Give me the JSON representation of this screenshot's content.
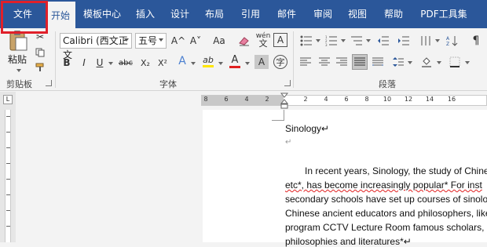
{
  "tabs": {
    "file": "文件",
    "home": "开始",
    "template": "模板中心",
    "insert": "插入",
    "design": "设计",
    "layout": "布局",
    "references": "引用",
    "mailings": "邮件",
    "review": "审阅",
    "view": "视图",
    "help": "帮助",
    "pdf": "PDF工具集"
  },
  "clipboard": {
    "paste_label": "粘贴",
    "group_label": "剪贴板"
  },
  "font": {
    "family": "Calibri (西文正文",
    "size": "五号",
    "group_label": "字体",
    "bold": "B",
    "italic": "I",
    "underline": "U",
    "strike": "abc",
    "subscript": "X₂",
    "superscript": "X²",
    "grow": "A^",
    "shrink": "A˅",
    "change_case": "Aa",
    "phonetic": "wén",
    "char_border": "A",
    "font_color": "A",
    "char_shading": "A",
    "text_effects": "A",
    "highlight": "ab"
  },
  "paragraph": {
    "group_label": "段落"
  },
  "ruler": {
    "ticks": [
      "8",
      "6",
      "4",
      "2",
      "2",
      "4",
      "6",
      "8",
      "10",
      "12",
      "14",
      "16"
    ],
    "corner": "L"
  },
  "document": {
    "lines": [
      "Sinology↵",
      "↵",
      "In recent years, Sinology, the study of Chinese",
      "etc*, has become increasingly popular* For inst",
      "secondary schools have set up courses of sinology,",
      "Chinese ancient educators and philosophers, like",
      "program CCTV Lecture Room famous scholars, e",
      "philosophies and literatures*↵"
    ]
  },
  "colors": {
    "tab_bar": "#2b579a",
    "highlight_box": "#e0202a",
    "font_color_bar": "#e02020",
    "highlight_bar": "#ffe600"
  }
}
